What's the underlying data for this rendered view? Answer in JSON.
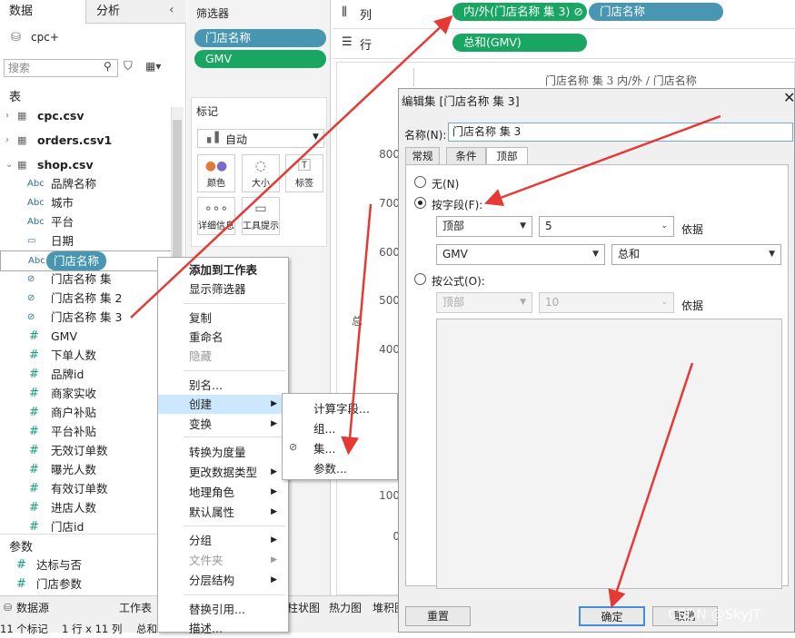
{
  "data_pane": {
    "tab_data": "数据",
    "tab_analysis": "分析",
    "datasource": "cpc+",
    "search_placeholder": "搜索",
    "tables_header": "表",
    "tables": [
      "cpc.csv",
      "orders.csv1",
      "shop.csv"
    ],
    "fields": [
      {
        "icon": "Abc",
        "label": "品牌名称"
      },
      {
        "icon": "Abc",
        "label": "城市"
      },
      {
        "icon": "Abc",
        "label": "平台"
      },
      {
        "icon": "date",
        "label": "日期"
      },
      {
        "icon": "Abc",
        "label": "门店名称"
      },
      {
        "icon": "set",
        "label": "门店名称 集"
      },
      {
        "icon": "set",
        "label": "门店名称 集 2"
      },
      {
        "icon": "set",
        "label": "门店名称 集 3"
      },
      {
        "icon": "#",
        "label": "GMV"
      },
      {
        "icon": "#",
        "label": "下单人数"
      },
      {
        "icon": "#",
        "label": "品牌id"
      },
      {
        "icon": "#",
        "label": "商家实收"
      },
      {
        "icon": "#",
        "label": "商户补贴"
      },
      {
        "icon": "#",
        "label": "平台补贴"
      },
      {
        "icon": "#",
        "label": "无效订单数"
      },
      {
        "icon": "#",
        "label": "曝光人数"
      },
      {
        "icon": "#",
        "label": "有效订单数"
      },
      {
        "icon": "#",
        "label": "进店人数"
      },
      {
        "icon": "#",
        "label": "门店id"
      }
    ],
    "params_header": "参数",
    "params": [
      "达标与否",
      "门店参数"
    ]
  },
  "bottom": {
    "tab_datasource": "数据源",
    "tab_worksheet": "工作表",
    "sheet_tabs": [
      "柱状图",
      "热力图",
      "堆积图"
    ],
    "status_records": "11 个标记",
    "status_rows": "1 行 x 11 列",
    "status_sum": "总和"
  },
  "filters": {
    "title": "筛选器",
    "items": [
      "门店名称",
      "GMV"
    ]
  },
  "marks": {
    "title": "标记",
    "type": "自动",
    "buttons": [
      "颜色",
      "大小",
      "标签",
      "详细信息",
      "工具提示"
    ]
  },
  "shelves": {
    "columns_label": "列",
    "columns_pills": [
      "内/外(门店名称 集 3)",
      "门店名称"
    ],
    "rows_label": "行",
    "rows_pills": [
      "总和(GMV)"
    ]
  },
  "view": {
    "header": "门店名称 集 3 内/外 / 门店名称",
    "y_ticks": [
      "800",
      "700",
      "600",
      "500",
      "400",
      "300",
      "200",
      "100",
      "0"
    ],
    "y_axis_glyph": "总"
  },
  "context_menu": {
    "items": [
      "添加到工作表",
      "显示筛选器",
      "复制",
      "重命名",
      "隐藏",
      "别名...",
      "创建",
      "变换",
      "转换为度量",
      "更改数据类型",
      "地理角色",
      "默认属性",
      "分组",
      "文件夹",
      "分层结构",
      "替换引用...",
      "描述..."
    ],
    "submenu": [
      "计算字段...",
      "组...",
      "集...",
      "参数..."
    ]
  },
  "dialog": {
    "title": "编辑集 [门店名称 集 3]",
    "name_label": "名称(N):",
    "name_value": "门店名称 集 3",
    "tabs": [
      "常规",
      "条件",
      "顶部"
    ],
    "radio_none": "无(N)",
    "radio_by_field": "按字段(F):",
    "top_value": "顶部",
    "count_value": "5",
    "by_label": "依据",
    "field_value": "GMV",
    "agg_value": "总和",
    "radio_by_formula": "按公式(O):",
    "formula_top": "顶部",
    "formula_count": "10",
    "formula_by": "依据",
    "reset_button": "重置",
    "ok_button": "确定",
    "cancel_button": "取消"
  },
  "watermark": "CSDN @SkyJT",
  "colors": {
    "blue_pill": "#4996b2",
    "green_pill": "#19a663",
    "arrow": "#e53935",
    "highlight": "#cce8ff"
  }
}
